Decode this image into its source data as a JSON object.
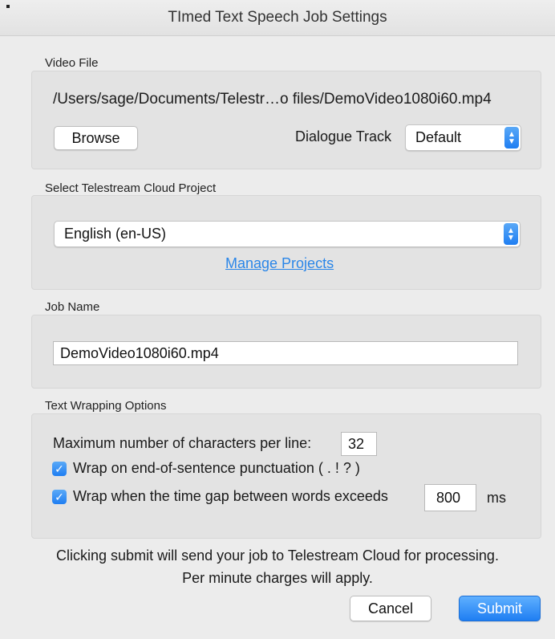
{
  "window": {
    "title": "TImed Text Speech Job Settings"
  },
  "video_file": {
    "section_label": "Video File",
    "path": "/Users/sage/Documents/Telestr…o files/DemoVideo1080i60.mp4",
    "browse_label": "Browse",
    "dialogue_track_label": "Dialogue Track",
    "dialogue_track_value": "Default"
  },
  "cloud_project": {
    "section_label": "Select Telestream Cloud Project",
    "selected": "English (en-US)",
    "manage_link": "Manage Projects"
  },
  "job_name": {
    "section_label": "Job Name",
    "value": "DemoVideo1080i60.mp4"
  },
  "text_wrapping": {
    "section_label": "Text Wrapping Options",
    "max_chars_label": "Maximum number of characters per line:",
    "max_chars_value": "32",
    "wrap_punct_label": "Wrap on end-of-sentence punctuation ( . ! ? )",
    "wrap_gap_label": "Wrap when the time gap between words exceeds",
    "wrap_gap_value": "800",
    "wrap_gap_unit": "ms"
  },
  "footer": {
    "info_line1": "Clicking submit will send your job to Telestream Cloud for processing.",
    "info_line2": "Per minute charges will apply.",
    "cancel_label": "Cancel",
    "submit_label": "Submit"
  },
  "colors": {
    "accent": "#1f7ef2",
    "link": "#2a86e8",
    "panel": "#e3e3e3"
  }
}
